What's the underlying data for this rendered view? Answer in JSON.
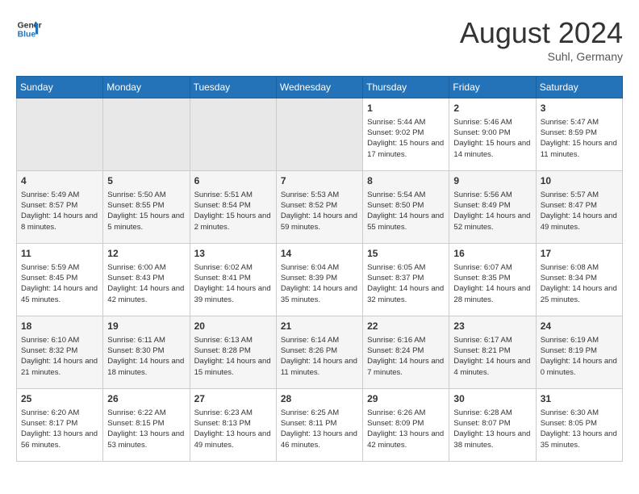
{
  "header": {
    "logo_line1": "General",
    "logo_line2": "Blue",
    "title": "August 2024",
    "subtitle": "Suhl, Germany"
  },
  "weekdays": [
    "Sunday",
    "Monday",
    "Tuesday",
    "Wednesday",
    "Thursday",
    "Friday",
    "Saturday"
  ],
  "weeks": [
    [
      {
        "day": "",
        "empty": true
      },
      {
        "day": "",
        "empty": true
      },
      {
        "day": "",
        "empty": true
      },
      {
        "day": "",
        "empty": true
      },
      {
        "day": "1",
        "sunrise": "5:44 AM",
        "sunset": "9:02 PM",
        "daylight": "15 hours and 17 minutes."
      },
      {
        "day": "2",
        "sunrise": "5:46 AM",
        "sunset": "9:00 PM",
        "daylight": "15 hours and 14 minutes."
      },
      {
        "day": "3",
        "sunrise": "5:47 AM",
        "sunset": "8:59 PM",
        "daylight": "15 hours and 11 minutes."
      }
    ],
    [
      {
        "day": "4",
        "sunrise": "5:49 AM",
        "sunset": "8:57 PM",
        "daylight": "14 hours and 8 minutes."
      },
      {
        "day": "5",
        "sunrise": "5:50 AM",
        "sunset": "8:55 PM",
        "daylight": "15 hours and 5 minutes."
      },
      {
        "day": "6",
        "sunrise": "5:51 AM",
        "sunset": "8:54 PM",
        "daylight": "15 hours and 2 minutes."
      },
      {
        "day": "7",
        "sunrise": "5:53 AM",
        "sunset": "8:52 PM",
        "daylight": "14 hours and 59 minutes."
      },
      {
        "day": "8",
        "sunrise": "5:54 AM",
        "sunset": "8:50 PM",
        "daylight": "14 hours and 55 minutes."
      },
      {
        "day": "9",
        "sunrise": "5:56 AM",
        "sunset": "8:49 PM",
        "daylight": "14 hours and 52 minutes."
      },
      {
        "day": "10",
        "sunrise": "5:57 AM",
        "sunset": "8:47 PM",
        "daylight": "14 hours and 49 minutes."
      }
    ],
    [
      {
        "day": "11",
        "sunrise": "5:59 AM",
        "sunset": "8:45 PM",
        "daylight": "14 hours and 45 minutes."
      },
      {
        "day": "12",
        "sunrise": "6:00 AM",
        "sunset": "8:43 PM",
        "daylight": "14 hours and 42 minutes."
      },
      {
        "day": "13",
        "sunrise": "6:02 AM",
        "sunset": "8:41 PM",
        "daylight": "14 hours and 39 minutes."
      },
      {
        "day": "14",
        "sunrise": "6:04 AM",
        "sunset": "8:39 PM",
        "daylight": "14 hours and 35 minutes."
      },
      {
        "day": "15",
        "sunrise": "6:05 AM",
        "sunset": "8:37 PM",
        "daylight": "14 hours and 32 minutes."
      },
      {
        "day": "16",
        "sunrise": "6:07 AM",
        "sunset": "8:35 PM",
        "daylight": "14 hours and 28 minutes."
      },
      {
        "day": "17",
        "sunrise": "6:08 AM",
        "sunset": "8:34 PM",
        "daylight": "14 hours and 25 minutes."
      }
    ],
    [
      {
        "day": "18",
        "sunrise": "6:10 AM",
        "sunset": "8:32 PM",
        "daylight": "14 hours and 21 minutes."
      },
      {
        "day": "19",
        "sunrise": "6:11 AM",
        "sunset": "8:30 PM",
        "daylight": "14 hours and 18 minutes."
      },
      {
        "day": "20",
        "sunrise": "6:13 AM",
        "sunset": "8:28 PM",
        "daylight": "14 hours and 15 minutes."
      },
      {
        "day": "21",
        "sunrise": "6:14 AM",
        "sunset": "8:26 PM",
        "daylight": "14 hours and 11 minutes."
      },
      {
        "day": "22",
        "sunrise": "6:16 AM",
        "sunset": "8:24 PM",
        "daylight": "14 hours and 7 minutes."
      },
      {
        "day": "23",
        "sunrise": "6:17 AM",
        "sunset": "8:21 PM",
        "daylight": "14 hours and 4 minutes."
      },
      {
        "day": "24",
        "sunrise": "6:19 AM",
        "sunset": "8:19 PM",
        "daylight": "14 hours and 0 minutes."
      }
    ],
    [
      {
        "day": "25",
        "sunrise": "6:20 AM",
        "sunset": "8:17 PM",
        "daylight": "13 hours and 56 minutes."
      },
      {
        "day": "26",
        "sunrise": "6:22 AM",
        "sunset": "8:15 PM",
        "daylight": "13 hours and 53 minutes."
      },
      {
        "day": "27",
        "sunrise": "6:23 AM",
        "sunset": "8:13 PM",
        "daylight": "13 hours and 49 minutes."
      },
      {
        "day": "28",
        "sunrise": "6:25 AM",
        "sunset": "8:11 PM",
        "daylight": "13 hours and 46 minutes."
      },
      {
        "day": "29",
        "sunrise": "6:26 AM",
        "sunset": "8:09 PM",
        "daylight": "13 hours and 42 minutes."
      },
      {
        "day": "30",
        "sunrise": "6:28 AM",
        "sunset": "8:07 PM",
        "daylight": "13 hours and 38 minutes."
      },
      {
        "day": "31",
        "sunrise": "6:30 AM",
        "sunset": "8:05 PM",
        "daylight": "13 hours and 35 minutes."
      }
    ]
  ],
  "labels": {
    "sunrise": "Sunrise:",
    "sunset": "Sunset:",
    "daylight": "Daylight:"
  }
}
